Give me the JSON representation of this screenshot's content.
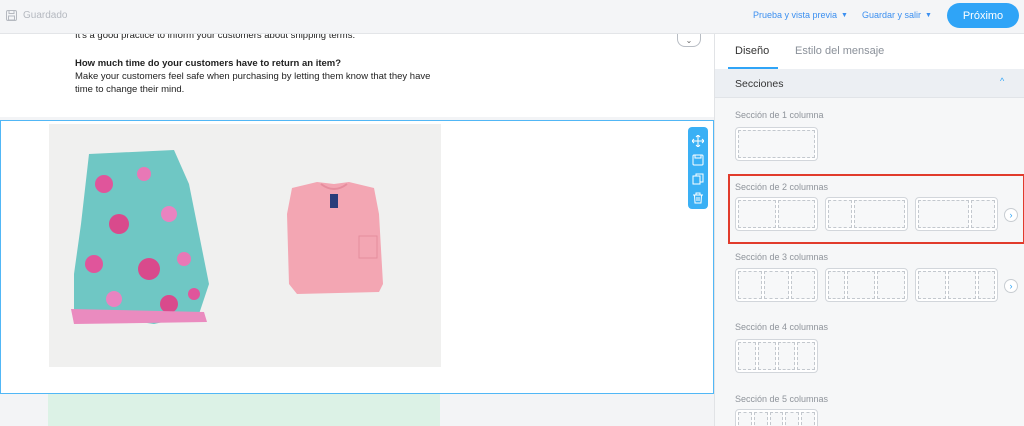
{
  "topbar": {
    "saved_label": "Guardado",
    "preview_label": "Prueba y vista previa",
    "save_exit_label": "Guardar y salir",
    "next_label": "Próximo"
  },
  "canvas": {
    "cut_text": "It's a good practice to inform your customers about shipping terms.",
    "question_heading": "How much time do your customers have to return an item?",
    "question_body": "Make your customers feel safe when purchasing by letting them know that they have time to change their mind."
  },
  "panel": {
    "tabs": [
      "Diseño",
      "Estilo del mensaje"
    ],
    "sections_title": "Secciones",
    "groups": [
      "Sección de 1 columna",
      "Sección de 2 columnas",
      "Sección de 3 columnas",
      "Sección de 4 columnas",
      "Sección de 5 columnas"
    ]
  },
  "colors": {
    "accent": "#2fa4f7",
    "highlight": "#e13b2c",
    "green_block": "#dcf2e6"
  }
}
